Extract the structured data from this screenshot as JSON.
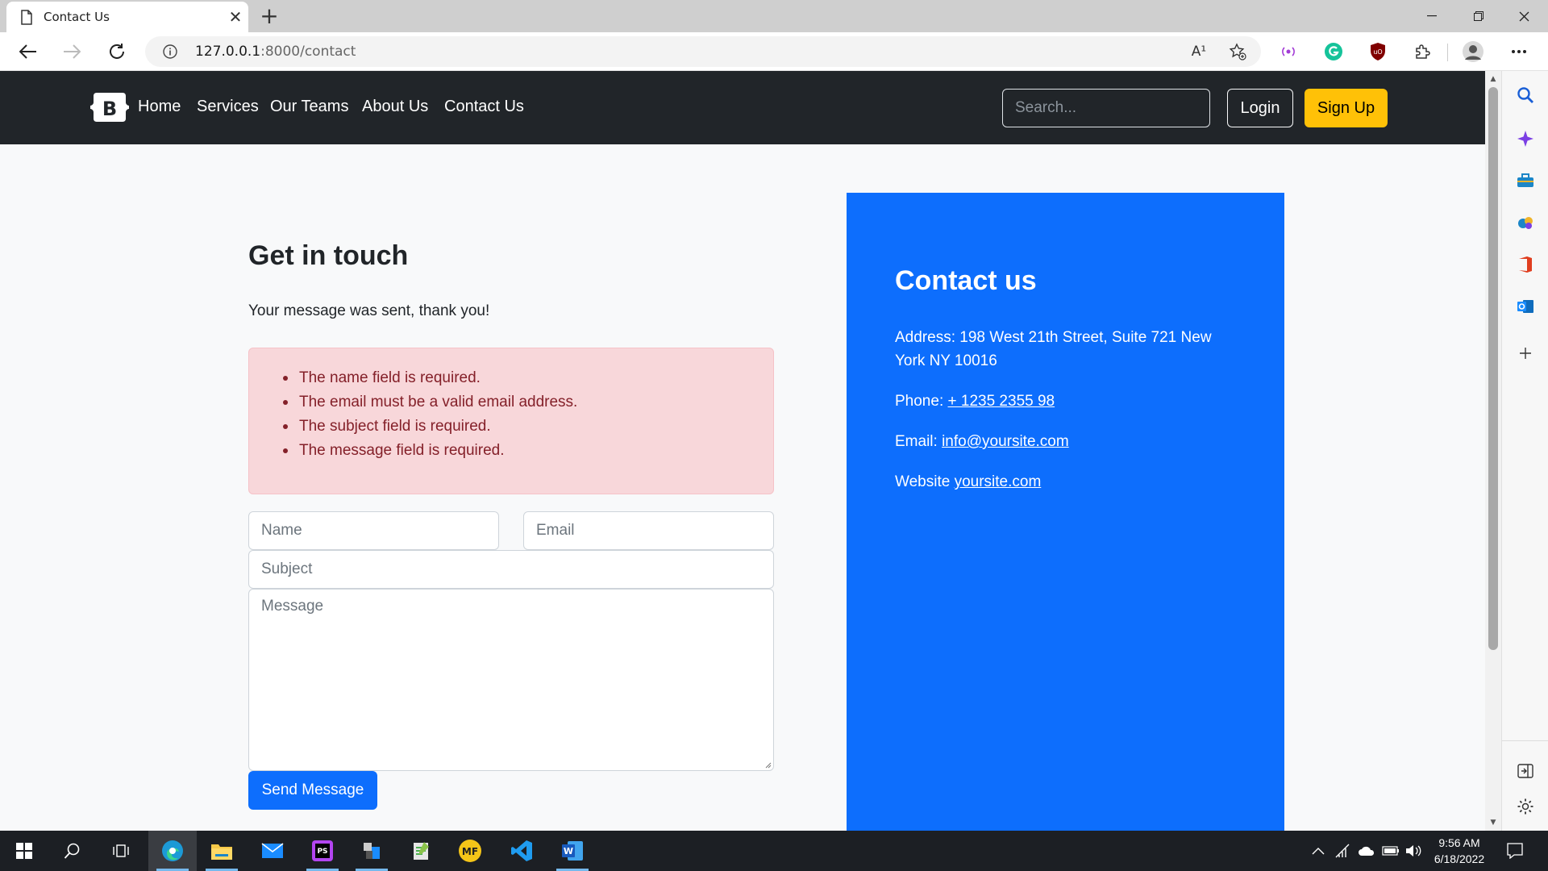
{
  "browser": {
    "tab_title": "Contact Us",
    "url_host": "127.0.0.1",
    "url_path": ":8000/contact",
    "read_aloud_label": "A¹"
  },
  "navbar": {
    "brand_letter": "B",
    "links": [
      "Home",
      "Services",
      "Our Teams",
      "About Us",
      "Contact Us"
    ],
    "search_placeholder": "Search...",
    "login_label": "Login",
    "signup_label": "Sign Up"
  },
  "contact_form": {
    "heading": "Get in touch",
    "success_message": "Your message was sent, thank you!",
    "errors": [
      "The name field is required.",
      "The email must be a valid email address.",
      "The subject field is required.",
      "The message field is required."
    ],
    "name_placeholder": "Name",
    "email_placeholder": "Email",
    "subject_placeholder": "Subject",
    "message_placeholder": "Message",
    "send_label": "Send Message"
  },
  "contact_info": {
    "heading": "Contact us",
    "address": "Address: 198 West 21th Street, Suite 721 New York NY 10016",
    "phone_label": "Phone:",
    "phone_value": "+ 1235 2355 98",
    "email_label": "Email:",
    "email_value": "info@yoursite.com",
    "website_label": "Website",
    "website_value": "yoursite.com"
  },
  "taskbar": {
    "apps": [
      "windows-start",
      "search",
      "task-view",
      "edge",
      "file-explorer",
      "mail",
      "phpstorm",
      "app-store",
      "notepad",
      "mf",
      "vscode",
      "word"
    ],
    "ps_label": "PS",
    "mf_label": "MF",
    "word_label": "W",
    "time": "9:56 AM",
    "date": "6/18/2022"
  },
  "colors": {
    "navbar_bg": "#212529",
    "signup_bg": "#ffc107",
    "primary": "#0d6efd",
    "alert_bg": "#f8d7da",
    "alert_text": "#842029"
  }
}
